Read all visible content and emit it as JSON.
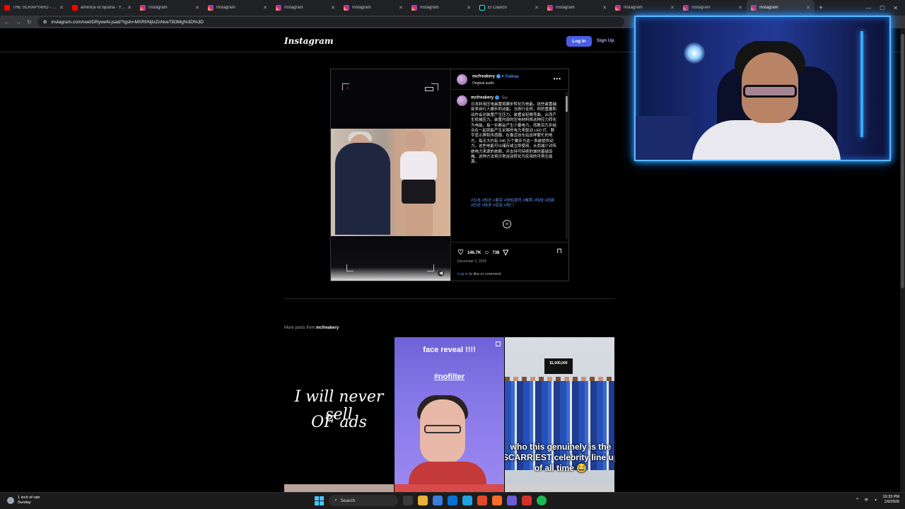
{
  "browser": {
    "tabs": [
      {
        "label": "THE SCRAPYARD - YouTube",
        "icon": "youtube-icon",
        "active": false
      },
      {
        "label": "america vs tijuana - YouTube",
        "icon": "youtube-icon",
        "active": false
      },
      {
        "label": "Instagram",
        "icon": "instagram-icon",
        "active": false
      },
      {
        "label": "Instagram",
        "icon": "instagram-icon",
        "active": false
      },
      {
        "label": "Instagram",
        "icon": "instagram-icon",
        "active": false
      },
      {
        "label": "Instagram",
        "icon": "instagram-icon",
        "active": false
      },
      {
        "label": "Instagram",
        "icon": "instagram-icon",
        "active": false
      },
      {
        "label": "El Clasico",
        "icon": "tiktok-icon",
        "active": false
      },
      {
        "label": "Instagram",
        "icon": "instagram-icon",
        "active": false
      },
      {
        "label": "Instagram",
        "icon": "instagram-icon",
        "active": false
      },
      {
        "label": "Instagram",
        "icon": "instagram-icon",
        "active": false
      },
      {
        "label": "Instagram",
        "icon": "instagram-icon",
        "active": true
      }
    ],
    "url": "instagram.com/reel/DRyweN-jsad/?igsh=MXR0NjIxZnNveTB3Mg%3D%3D"
  },
  "instagram": {
    "logo": "Instagram",
    "login_button": "Log In",
    "signup_link": "Sign Up",
    "post": {
      "username": "mcfreakery",
      "follow": "Follow",
      "audio": "Original audio",
      "time_ago": "5w",
      "caption": "日本利用压电装置将脚步转化为电能。这些装置捕捉来自行人脚步的动能。当你行走时，你的重量和动作会对装置产生压力。装置会轻微弯曲，从而产生机械应力。装置内部的压电材料将这种应力转化为电能。每一步都会产生少量电力，而数百万步结合在一起就能产生足够的电力来驱动 LED 灯、数字显示屏和传感器。在像涩谷车站这样繁忙的地方，每天大约有 240 万个脚步为这一系统提供动力。这些电能可以储存或立即使用，从而减少对传统电力来源的依赖，并支持可持续的城市基础设施。这种方法将日常运动转化为实用的可再生能源。",
      "hashtags": "#日本 #知识 #事实 #你知道吗 #推荐 #科技 #创新 #历史 #技术 #实验 #热门",
      "likes": "146.7K",
      "comments": "738",
      "date": "December 2, 2025",
      "login_link": "Log in",
      "login_suffix": " to like or comment."
    },
    "more_posts_prefix": "More posts from ",
    "more_posts_user": "mcfreakery",
    "thumbnails": [
      {
        "line1": "I will never sell",
        "line2": "OF ads"
      },
      {
        "line1": "face reveal !!!!",
        "line2": "#nofilter"
      },
      {
        "sign": "$1,000,000",
        "caption": "who this genuinely is the SCARRIEST celebrity line up of all time 😂"
      }
    ]
  },
  "taskbar": {
    "weather_line1": "1 inch of rain",
    "weather_line2": "Sunday",
    "search_placeholder": "Search",
    "time": "10:33 PM",
    "date": "1/9/2026"
  },
  "colors": {
    "instagram_blue": "#4a5de8",
    "link_blue": "#4d8bf5",
    "webcam_glow": "#36a4ff"
  }
}
